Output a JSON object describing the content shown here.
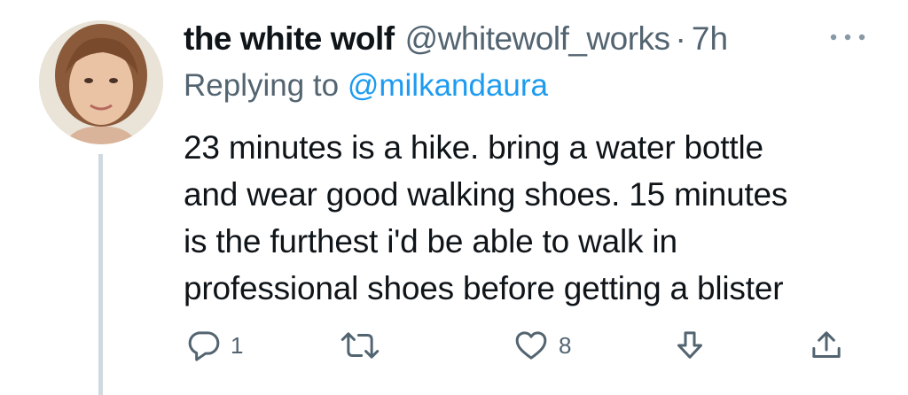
{
  "tweet": {
    "display_name": "the white wolf",
    "handle": "@whitewolf_works",
    "separator": "·",
    "time": "7h",
    "replying_prefix": "Replying to ",
    "replying_to": "@milkandaura",
    "text_lines": [
      "23 minutes is a hike. bring a water bottle",
      "and wear good walking shoes. 15 minutes",
      "is the furthest i'd be able to walk in",
      "professional shoes before getting a blister"
    ],
    "actions": {
      "reply_count": "1",
      "retweet_count": "",
      "like_count": "8"
    },
    "icons": [
      "more-icon",
      "reply-icon",
      "retweet-icon",
      "like-icon",
      "share-icon",
      "upload-icon"
    ]
  },
  "colors": {
    "text": "#0f1419",
    "secondary": "#536471",
    "link": "#1d9bf0",
    "thread_line": "#cfd9de"
  }
}
